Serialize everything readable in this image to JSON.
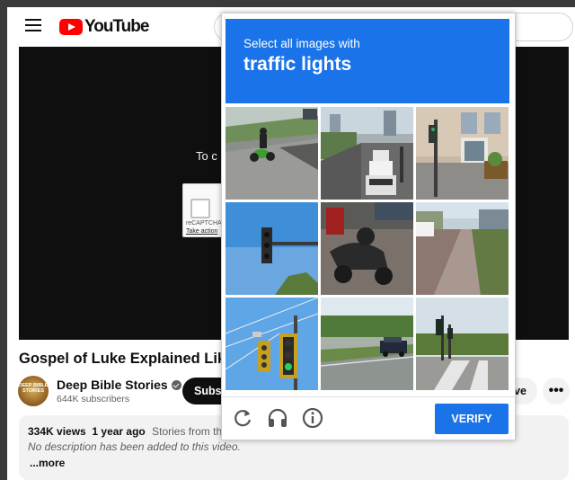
{
  "youtube": {
    "logo_text": "YouTube",
    "player_message": "To c",
    "recaptcha_label": "reCAPTCHA",
    "recaptcha_link": "Take action",
    "video_title": "Gospel of Luke Explained Like",
    "channel": {
      "name": "Deep Bible Stories",
      "subscribers": "644K subscribers",
      "avatar_text": "DEEP BIBLE STORIES"
    },
    "subscribe_label": "Subsc",
    "save_label": "ve",
    "more_label": "•••",
    "description": {
      "views": "334K views",
      "age": "1 year ago",
      "tags": "Stories from the B",
      "text": "No description has been added to this video.",
      "more": "...more"
    }
  },
  "captcha": {
    "instruction": "Select all images with",
    "target": "traffic lights",
    "verify_label": "VERIFY",
    "icons": [
      "reload-icon",
      "headphones-icon",
      "info-icon"
    ],
    "tiles": [
      "motorcycle-on-road",
      "traffic-jam-street",
      "building-with-traffic-light",
      "traffic-light-sky",
      "parked-scooter",
      "sidewalk-street",
      "traffic-light-closeup",
      "car-on-highway",
      "intersection-traffic-light"
    ]
  },
  "colors": {
    "captcha_blue": "#1a73e8",
    "youtube_red": "#ff0000"
  }
}
